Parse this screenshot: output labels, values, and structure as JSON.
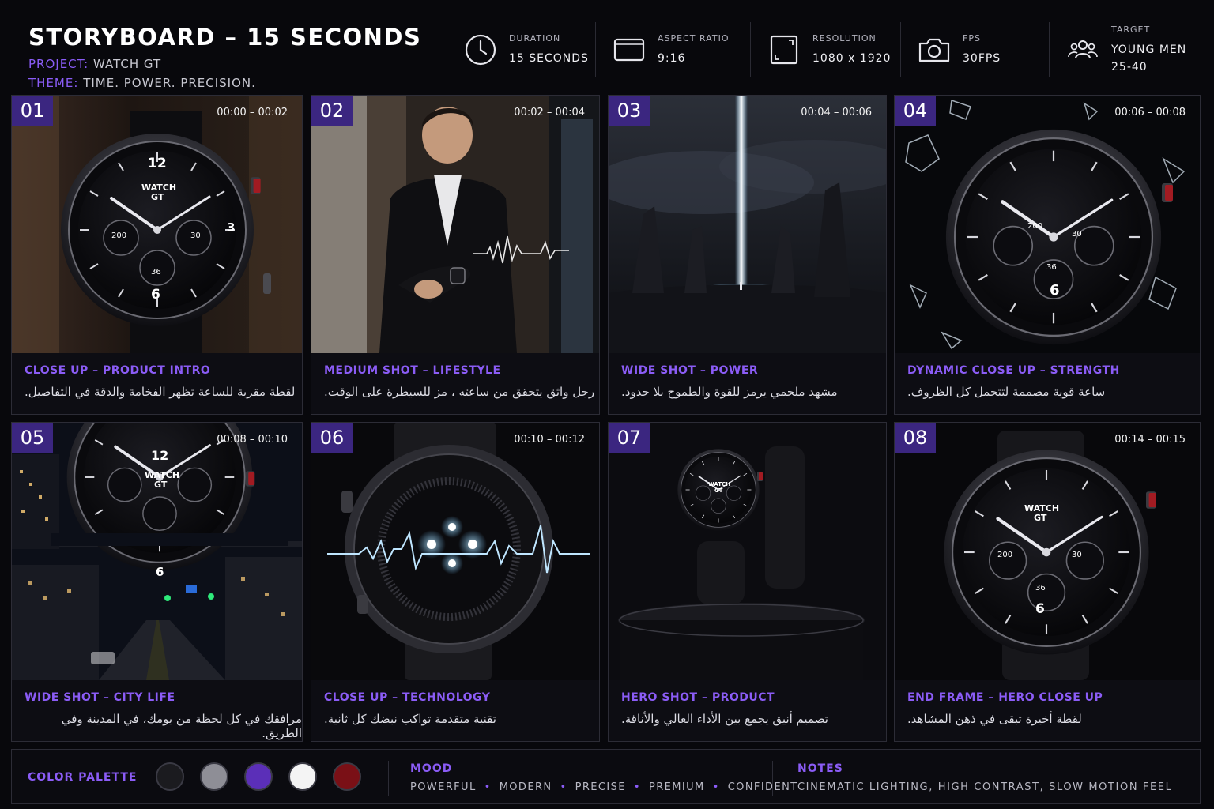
{
  "header": {
    "title": "STORYBOARD – 15 SECONDS",
    "project_key": "PROJECT:",
    "project_val": "WATCH GT",
    "theme_key": "THEME:",
    "theme_val": "TIME. POWER. PRECISION."
  },
  "specs": [
    {
      "icon": "clock-icon",
      "label": "DURATION",
      "value": "15 SECONDS"
    },
    {
      "icon": "aspect-ratio-icon",
      "label": "ASPECT RATIO",
      "value": "9:16"
    },
    {
      "icon": "resolution-icon",
      "label": "RESOLUTION",
      "value": "1080 x 1920"
    },
    {
      "icon": "camera-icon",
      "label": "FPS",
      "value": "30FPS"
    },
    {
      "icon": "target-audience-icon",
      "label": "TARGET",
      "value": "YOUNG MEN",
      "value2": "25-40"
    }
  ],
  "shots": [
    {
      "num": "01",
      "time": "00:00 – 00:02",
      "title": "CLOSE UP – PRODUCT INTRO",
      "desc": "لقطة مقربة للساعة تظهر الفخامة والدقة في التفاصيل."
    },
    {
      "num": "02",
      "time": "00:02 – 00:04",
      "title": "MEDIUM SHOT – LIFESTYLE",
      "desc": "رجل واثق يتحقق من ساعته ، مز للسيطرة على الوقت."
    },
    {
      "num": "03",
      "time": "00:04 – 00:06",
      "title": "WIDE SHOT – POWER",
      "desc": "مشهد ملحمي يرمز للقوة والطموح بلا حدود."
    },
    {
      "num": "04",
      "time": "00:06 – 00:08",
      "title": "DYNAMIC CLOSE UP – STRENGTH",
      "desc": "ساعة قوية مصممة لتتحمل كل الظروف."
    },
    {
      "num": "05",
      "time": "00:08 – 00:10",
      "title": "WIDE SHOT – CITY LIFE",
      "desc": "مرافقك في كل لحظة من يومك، في المدينة وفي الطريق."
    },
    {
      "num": "06",
      "time": "00:10 – 00:12",
      "title": "CLOSE UP – TECHNOLOGY",
      "desc": "تقنية متقدمة تواكب نبضك كل ثانية."
    },
    {
      "num": "07",
      "time": "",
      "title": "HERO SHOT – PRODUCT",
      "desc": "تصميم أنيق يجمع بين الأداء العالي والأناقة."
    },
    {
      "num": "08",
      "time": "00:14 – 00:15",
      "title": "END FRAME – HERO CLOSE UP",
      "desc": "لقطة أخيرة تبقى في ذهن المشاهد."
    }
  ],
  "watch_face": {
    "brand": "WATCH",
    "model": "GT",
    "n12": "12",
    "n3": "3",
    "n6": "6",
    "sub_left": "200",
    "sub_right": "30",
    "sub_bottom": "36"
  },
  "footer": {
    "palette_label": "COLOR PALETTE",
    "palette": [
      "#1b1b1f",
      "#8e8e96",
      "#5b2fb8",
      "#f4f4f4",
      "#7a1016"
    ],
    "mood_label": "MOOD",
    "mood": [
      "POWERFUL",
      "MODERN",
      "PRECISE",
      "PREMIUM",
      "CONFIDENT"
    ],
    "notes_label": "NOTES",
    "notes": "CINEMATIC LIGHTING, HIGH CONTRAST, SLOW MOTION FEEL"
  },
  "colors": {
    "accent": "#8b5cf6",
    "badge": "#3b2680",
    "background": "#08080c"
  }
}
